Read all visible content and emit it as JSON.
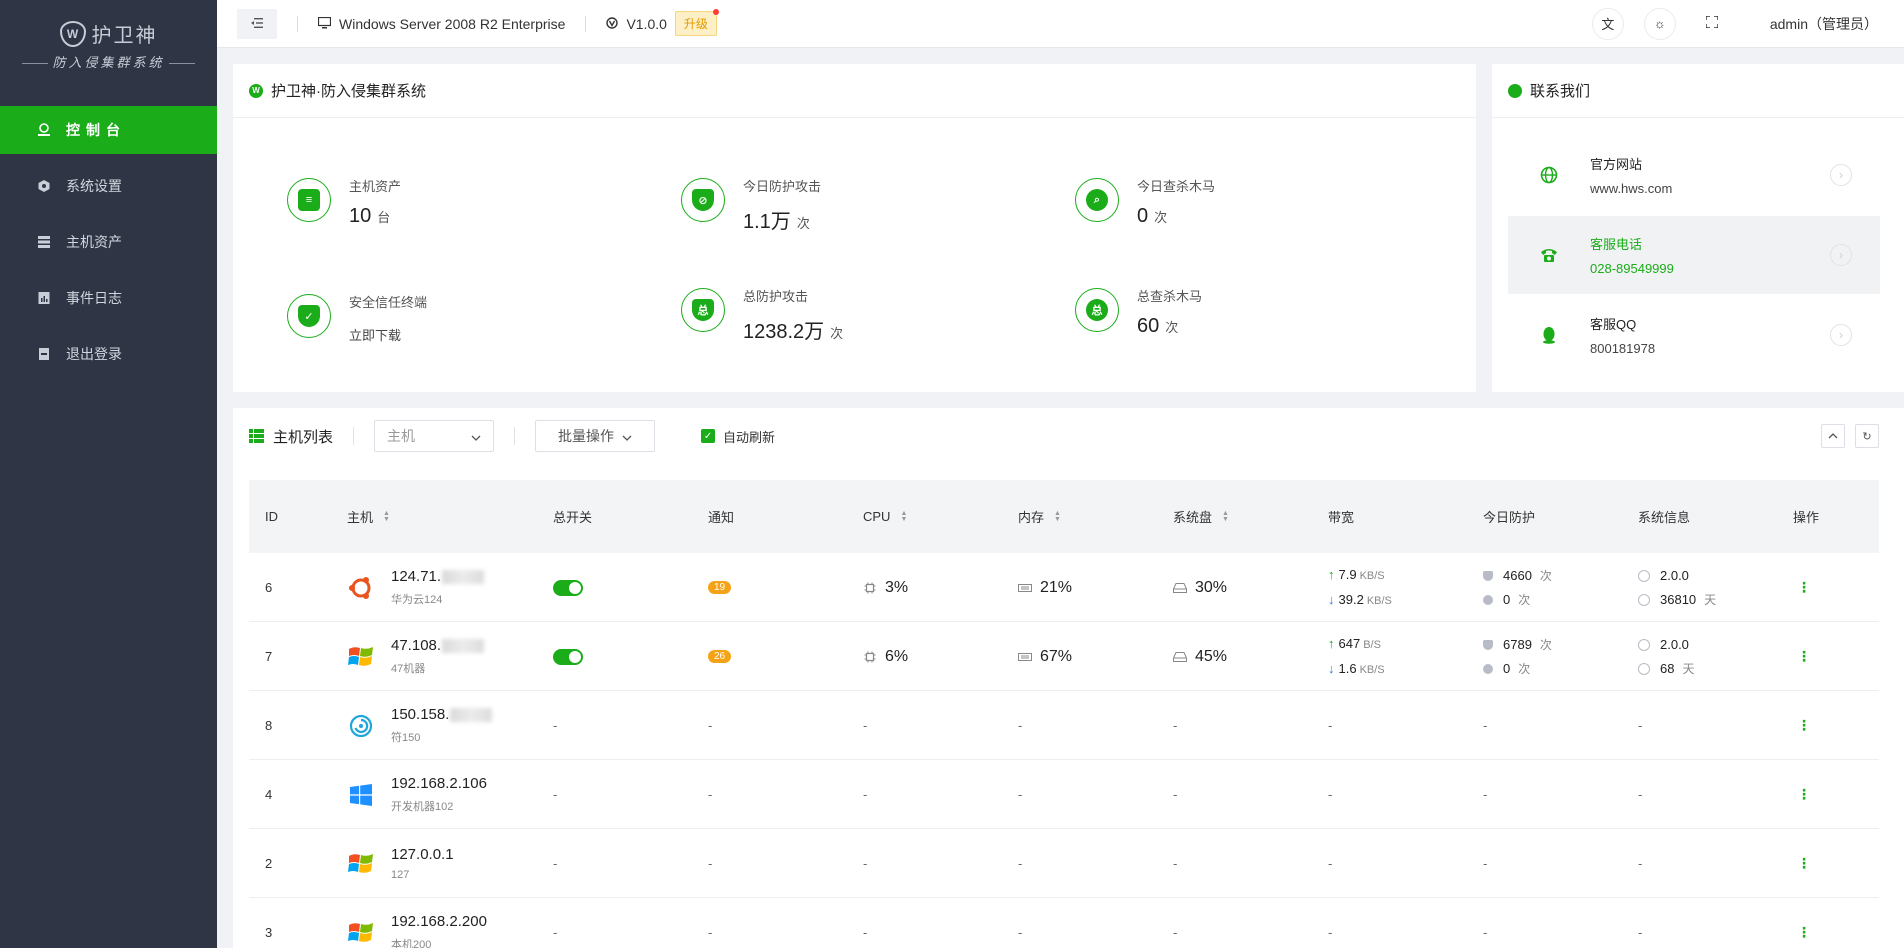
{
  "brand": {
    "title": "护卫神",
    "subtitle": "防入侵集群系统"
  },
  "sidebar": {
    "items": [
      {
        "label": "控制台",
        "icon": "dashboard-icon",
        "active": true
      },
      {
        "label": "系统设置",
        "icon": "settings-icon",
        "active": false
      },
      {
        "label": "主机资产",
        "icon": "server-icon",
        "active": false
      },
      {
        "label": "事件日志",
        "icon": "log-icon",
        "active": false
      },
      {
        "label": "退出登录",
        "icon": "logout-icon",
        "active": false
      }
    ]
  },
  "topbar": {
    "os": "Windows Server 2008 R2 Enterprise",
    "version": "V1.0.0",
    "upgrade": "升级",
    "user": "admin（管理员）"
  },
  "overview": {
    "title": "护卫神·防入侵集群系统",
    "stats": [
      {
        "label": "主机资产",
        "value": "10",
        "unit": "台",
        "icon": "host-assets-icon"
      },
      {
        "label": "今日防护攻击",
        "value": "1.1万",
        "unit": "次",
        "icon": "shield-today-icon"
      },
      {
        "label": "今日查杀木马",
        "value": "0",
        "unit": "次",
        "icon": "trojan-scan-today-icon"
      },
      {
        "label": "安全信任终端",
        "link": "立即下载",
        "icon": "trusted-terminal-icon"
      },
      {
        "label": "总防护攻击",
        "value": "1238.2万",
        "unit": "次",
        "icon": "shield-total-icon"
      },
      {
        "label": "总查杀木马",
        "value": "60",
        "unit": "次",
        "icon": "trojan-scan-total-icon"
      }
    ]
  },
  "contact": {
    "title": "联系我们",
    "items": [
      {
        "label": "官方网站",
        "value": "www.hws.com",
        "icon": "globe-icon"
      },
      {
        "label": "客服电话",
        "value": "028-89549999",
        "icon": "phone-icon"
      },
      {
        "label": "客服QQ",
        "value": "800181978",
        "icon": "qq-icon"
      }
    ]
  },
  "hosts": {
    "title": "主机列表",
    "filter_placeholder": "主机",
    "batch_label": "批量操作",
    "auto_refresh": "自动刷新",
    "columns": [
      "ID",
      "主机",
      "总开关",
      "通知",
      "CPU",
      "内存",
      "系统盘",
      "带宽",
      "今日防护",
      "系统信息",
      "操作"
    ],
    "rows": [
      {
        "id": "6",
        "ip": "124.71.",
        "name": "华为云124",
        "os": "ubuntu",
        "switch_on": true,
        "notify": "19",
        "cpu": "3%",
        "mem": "21%",
        "disk": "30%",
        "up": "7.9",
        "up_unit": "KB/S",
        "down": "39.2",
        "down_unit": "KB/S",
        "prot_attack": "4660",
        "prot_attack_unit": "次",
        "prot_other": "0",
        "prot_other_unit": "次",
        "version": "2.0.0",
        "uptime": "36810",
        "uptime_unit": "天"
      },
      {
        "id": "7",
        "ip": "47.108.",
        "name": "47机器",
        "os": "windows-old",
        "switch_on": true,
        "notify": "26",
        "cpu": "6%",
        "mem": "67%",
        "disk": "45%",
        "up": "647",
        "up_unit": "B/S",
        "down": "1.6",
        "down_unit": "KB/S",
        "prot_attack": "6789",
        "prot_attack_unit": "次",
        "prot_other": "0",
        "prot_other_unit": "次",
        "version": "2.0.0",
        "uptime": "68",
        "uptime_unit": "天"
      },
      {
        "id": "8",
        "ip": "150.158.",
        "name": "符150",
        "os": "debian",
        "dash": "-"
      },
      {
        "id": "4",
        "ip": "192.168.2.106",
        "name": "开发机器102",
        "os": "windows-new",
        "dash": "-"
      },
      {
        "id": "2",
        "ip": "127.0.0.1",
        "name": "127",
        "os": "windows-old",
        "dash": "-"
      },
      {
        "id": "3",
        "ip": "192.168.2.200",
        "name": "本机200",
        "os": "windows-old",
        "dash": "-"
      }
    ]
  },
  "colors": {
    "accent": "#1aad19",
    "sidebar": "#2f3545",
    "badge": "#f5a316"
  }
}
